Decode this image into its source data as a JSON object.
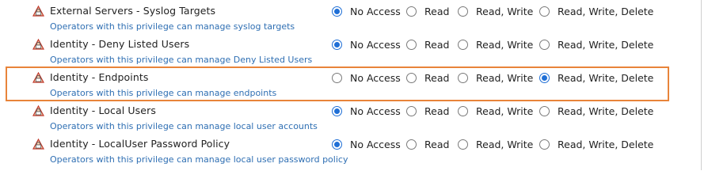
{
  "privileges": [
    {
      "name": "External Servers - Syslog Targets",
      "description": "Operators with this privilege can manage syslog targets",
      "selected": 0,
      "highlighted": false,
      "icon": "privilege-icon"
    },
    {
      "name": "Identity - Deny Listed Users",
      "description": "Operators with this privilege can manage Deny Listed Users",
      "selected": 0,
      "highlighted": false,
      "icon": "privilege-icon"
    },
    {
      "name": "Identity - Endpoints",
      "description": "Operators with this privilege can manage endpoints",
      "selected": 3,
      "highlighted": true,
      "icon": "privilege-icon"
    },
    {
      "name": "Identity - Local Users",
      "description": "Operators with this privilege can manage local user accounts",
      "selected": 0,
      "highlighted": false,
      "icon": "privilege-icon"
    },
    {
      "name": "Identity - LocalUser Password Policy",
      "description": "Operators with this privilege can manage local user password policy",
      "selected": 0,
      "highlighted": false,
      "icon": "privilege-icon"
    }
  ],
  "access_options": [
    "No Access",
    "Read",
    "Read, Write",
    "Read, Write, Delete"
  ],
  "colors": {
    "highlight_border": "#e8843a",
    "link_blue": "#2f6fb3",
    "radio_selected": "#1f6fd6"
  }
}
